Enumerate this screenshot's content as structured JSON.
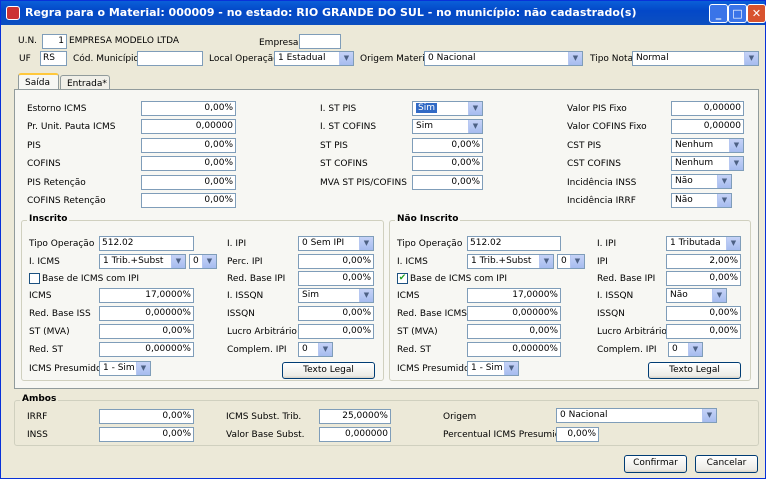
{
  "window": {
    "title": "Regra para o Material: 000009 - no estado: RIO GRANDE DO SUL - no município: não cadastrado(s)"
  },
  "header": {
    "un_label": "U.N.",
    "un_value": "1",
    "un_name": "EMPRESA MODELO LTDA",
    "empresa_label": "Empresa",
    "empresa_value": "",
    "uf_label": "UF",
    "uf_value": "RS",
    "cod_municipio_label": "Cód. Município",
    "cod_municipio_value": "",
    "local_operacao_label": "Local Operação",
    "local_operacao_value": "1 Estadual",
    "origem_material_label": "Origem Material",
    "origem_material_value": "0 Nacional",
    "tipo_nota_label": "Tipo Nota",
    "tipo_nota_value": "Normal"
  },
  "tabs": [
    {
      "label": "Saída"
    },
    {
      "label": "Entrada*"
    }
  ],
  "saida": {
    "col1": [
      {
        "label": "Estorno ICMS",
        "value": "0,00%"
      },
      {
        "label": "Pr. Unit. Pauta ICMS",
        "value": "0,00000"
      },
      {
        "label": "PIS",
        "value": "0,00%"
      },
      {
        "label": "COFINS",
        "value": "0,00%"
      },
      {
        "label": "PIS Retenção",
        "value": "0,00%"
      },
      {
        "label": "COFINS Retenção",
        "value": "0,00%"
      }
    ],
    "col2": [
      {
        "label": "I. ST PIS",
        "value": "Sim"
      },
      {
        "label": "I. ST COFINS",
        "value": "Sim"
      },
      {
        "label": "ST PIS",
        "value": "0,00%"
      },
      {
        "label": "ST COFINS",
        "value": "0,00%"
      },
      {
        "label": "MVA ST PIS/COFINS",
        "value": "0,00%"
      }
    ],
    "col3": [
      {
        "label": "Valor PIS Fixo",
        "value": "0,00000"
      },
      {
        "label": "Valor COFINS Fixo",
        "value": "0,00000"
      },
      {
        "label": "CST PIS",
        "value": "Nenhum"
      },
      {
        "label": "CST COFINS",
        "value": "Nenhum"
      },
      {
        "label": "Incidência INSS",
        "value": "Não"
      },
      {
        "label": "Incidência IRRF",
        "value": "Não"
      }
    ]
  },
  "inscrito": {
    "title": "Inscrito",
    "tipo_operacao_label": "Tipo Operação",
    "tipo_operacao_value": "512.02",
    "icms_label": "I. ICMS",
    "icms_value": "1 Trib.+Subst",
    "icms_sub_value": "0",
    "base_icms_label": "Base de ICMS com IPI",
    "base_icms_checked": "",
    "icms_pct_label": "ICMS",
    "icms_pct_value": "17,0000%",
    "red_base_iss_label": "Red. Base ISS",
    "red_base_iss_value": "0,00000%",
    "st_mva_label": "ST (MVA)",
    "st_mva_value": "0,00%",
    "red_st_label": "Red. ST",
    "red_st_value": "0,00000%",
    "icms_presumido_label": "ICMS Presumido",
    "icms_presumido_value": "1 - Sim",
    "ipi_label": "I. IPI",
    "ipi_value": "0 Sem IPI",
    "perc_ipi_label": "Perc. IPI",
    "perc_ipi_value": "0,00%",
    "red_base_ipi_label": "Red. Base IPI",
    "red_base_ipi_value": "0,00%",
    "issqn_i_label": "I. ISSQN",
    "issqn_i_value": "Sim",
    "issqn_label": "ISSQN",
    "issqn_value": "0,00%",
    "lucro_label": "Lucro Arbitrário",
    "lucro_value": "0,00%",
    "complem_ipi_label": "Complem. IPI",
    "complem_ipi_value": "0",
    "texto_legal_label": "Texto Legal"
  },
  "nao_inscrito": {
    "title": "Não Inscrito",
    "tipo_operacao_label": "Tipo Operação",
    "tipo_operacao_value": "512.02",
    "icms_label": "I. ICMS",
    "icms_value": "1 Trib.+Subst",
    "icms_sub_value": "0",
    "base_icms_label": "Base de ICMS com IPI",
    "base_icms_checked": "✔",
    "icms_pct_label": "ICMS",
    "icms_pct_value": "17,0000%",
    "red_base_icms_label": "Red. Base ICMS",
    "red_base_icms_value": "0,00000%",
    "st_mva_label": "ST (MVA)",
    "st_mva_value": "0,00%",
    "red_st_label": "Red. ST",
    "red_st_value": "0,00000%",
    "icms_presumido_label": "ICMS Presumido",
    "icms_presumido_value": "1 - Sim",
    "ipi_label": "I. IPI",
    "ipi_value": "1 Tributada",
    "perc_ipi_label": "IPI",
    "perc_ipi_value": "2,00%",
    "red_base_ipi_label": "Red. Base IPI",
    "red_base_ipi_value": "0,00%",
    "issqn_i_label": "I. ISSQN",
    "issqn_i_value": "Não",
    "issqn_label": "ISSQN",
    "issqn_value": "0,00%",
    "lucro_label": "Lucro Arbitrário",
    "lucro_value": "0,00%",
    "complem_ipi_label": "Complem. IPI",
    "complem_ipi_value": "0",
    "texto_legal_label": "Texto Legal"
  },
  "ambos": {
    "title": "Ambos",
    "irrf_label": "IRRF",
    "irrf_value": "0,00%",
    "inss_label": "INSS",
    "inss_value": "0,00%",
    "icms_subst_trib_label": "ICMS Subst. Trib.",
    "icms_subst_trib_value": "25,0000%",
    "valor_base_subst_label": "Valor Base Subst.",
    "valor_base_subst_value": "0,000000",
    "origem_label": "Origem",
    "origem_value": "0 Nacional",
    "percentual_icms_presumido_label": "Percentual ICMS Presumido",
    "percentual_icms_presumido_value": "0,00%"
  },
  "footer": {
    "confirmar_label": "Confirmar",
    "cancelar_label": "Cancelar"
  }
}
